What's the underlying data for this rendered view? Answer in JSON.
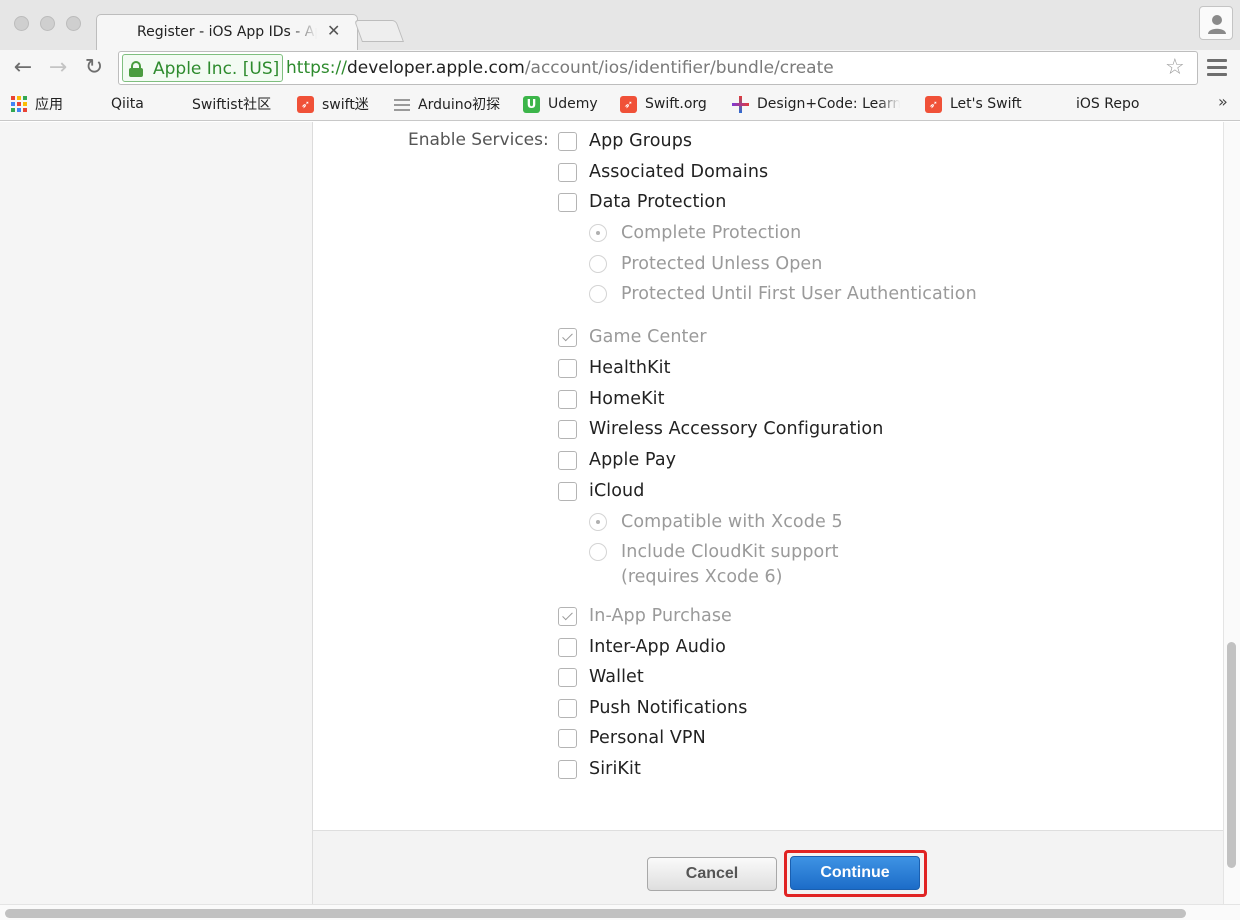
{
  "browser": {
    "tab": {
      "title": "Register - iOS App IDs - Apple Developer",
      "close_glyph": "✕"
    },
    "toolbar": {
      "back_glyph": "←",
      "forward_glyph": "→",
      "reload_glyph": "↻",
      "ev_name": "Apple Inc. [US]",
      "url_scheme": "https://",
      "url_host": "developer.apple.com",
      "url_path": "/account/ios/identifier/bundle/create",
      "star_glyph": "☆"
    },
    "bookmarks": [
      {
        "label": "应用",
        "icon": "apps-grid-icon"
      },
      {
        "label": "Qiita",
        "icon": "page-icon"
      },
      {
        "label": "Swiftist社区",
        "icon": "page-icon"
      },
      {
        "label": "swift迷",
        "icon": "swift-icon"
      },
      {
        "label": "Arduino初探",
        "icon": "list-icon"
      },
      {
        "label": "Udemy",
        "icon": "udemy-icon",
        "glyph": "U"
      },
      {
        "label": "Swift.org",
        "icon": "swift-icon"
      },
      {
        "label": "Design+Code: Learn",
        "icon": "plus-icon"
      },
      {
        "label": "Let's Swift",
        "icon": "swift-icon"
      },
      {
        "label": "iOS Repo",
        "icon": "page-icon"
      }
    ],
    "bookmarks_overflow": "»"
  },
  "form": {
    "enable_services_label": "Enable Services:",
    "services": {
      "app_groups": "App Groups",
      "associated_domains": "Associated Domains",
      "data_protection": "Data Protection",
      "complete_protection": "Complete Protection",
      "protected_unless_open": "Protected Unless Open",
      "protected_until_auth": "Protected Until First User Authentication",
      "game_center": "Game Center",
      "healthkit": "HealthKit",
      "homekit": "HomeKit",
      "wireless_accessory": "Wireless Accessory Configuration",
      "apple_pay": "Apple Pay",
      "icloud": "iCloud",
      "compatible_xcode5": "Compatible with Xcode 5",
      "include_cloudkit": "Include CloudKit support",
      "include_cloudkit_note": "(requires Xcode 6)",
      "in_app_purchase": "In-App Purchase",
      "inter_app_audio": "Inter-App Audio",
      "wallet": "Wallet",
      "push_notifications": "Push Notifications",
      "personal_vpn": "Personal VPN",
      "sirikit": "SiriKit"
    },
    "buttons": {
      "cancel": "Cancel",
      "continue": "Continue"
    },
    "highlight_color": "#e02424"
  },
  "colors": {
    "ev_green": "#2e8b2e",
    "continue_blue": "#1c6cc8"
  }
}
